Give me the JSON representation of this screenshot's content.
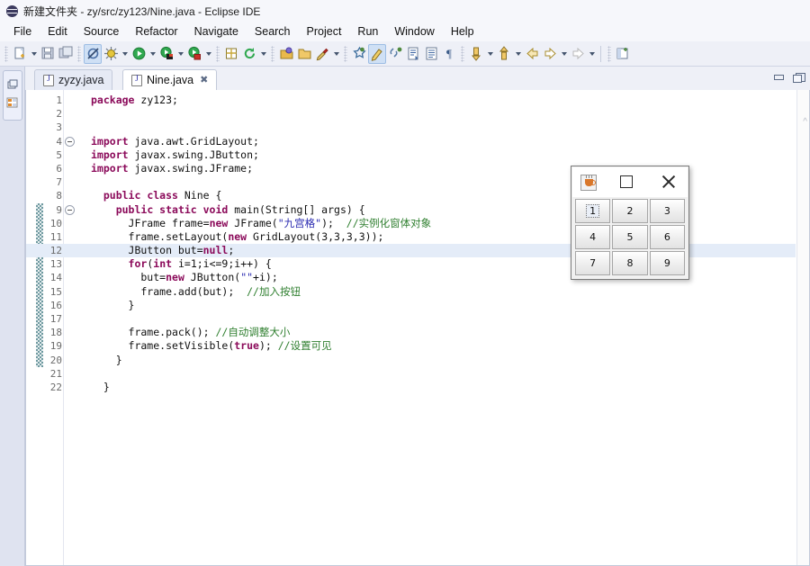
{
  "window": {
    "title": "新建文件夹 - zy/src/zy123/Nine.java - Eclipse IDE",
    "app_icon": "eclipse-icon"
  },
  "menubar": {
    "items": [
      {
        "label": "File",
        "name": "menu-file"
      },
      {
        "label": "Edit",
        "name": "menu-edit"
      },
      {
        "label": "Source",
        "name": "menu-source"
      },
      {
        "label": "Refactor",
        "name": "menu-refactor"
      },
      {
        "label": "Navigate",
        "name": "menu-navigate"
      },
      {
        "label": "Search",
        "name": "menu-search"
      },
      {
        "label": "Project",
        "name": "menu-project"
      },
      {
        "label": "Run",
        "name": "menu-run"
      },
      {
        "label": "Window",
        "name": "menu-window"
      },
      {
        "label": "Help",
        "name": "menu-help"
      }
    ]
  },
  "toolbar": {
    "groups": [
      {
        "items": [
          {
            "icon": "new-file-icon",
            "arrow": true,
            "selected": false
          },
          {
            "icon": "save-icon",
            "arrow": false,
            "selected": false
          },
          {
            "icon": "save-all-icon",
            "arrow": false,
            "selected": false
          }
        ]
      },
      {
        "items": [
          {
            "icon": "skip-all-breakpoints-icon",
            "arrow": false,
            "selected": true
          },
          {
            "icon": "debug-icon",
            "arrow": true,
            "selected": false
          },
          {
            "icon": "run-icon",
            "arrow": true,
            "selected": false
          },
          {
            "icon": "run-coverage-icon",
            "arrow": true,
            "selected": false
          },
          {
            "icon": "profile-icon",
            "arrow": true,
            "selected": false
          }
        ]
      },
      {
        "items": [
          {
            "icon": "new-java-package-icon",
            "arrow": false,
            "selected": false
          },
          {
            "icon": "refresh-icon",
            "arrow": true,
            "selected": false
          }
        ]
      },
      {
        "items": [
          {
            "icon": "open-type-icon",
            "arrow": false,
            "selected": false
          },
          {
            "icon": "open-resource-icon",
            "arrow": false,
            "selected": false
          },
          {
            "icon": "search-icon",
            "arrow": true,
            "selected": false
          }
        ]
      },
      {
        "items": [
          {
            "icon": "new-annotation-icon",
            "arrow": false,
            "selected": false
          },
          {
            "icon": "toggle-mark-occurrences-icon",
            "arrow": false,
            "selected": true
          },
          {
            "icon": "link-editor-icon",
            "arrow": false,
            "selected": false
          },
          {
            "icon": "show-source-icon",
            "arrow": false,
            "selected": false
          },
          {
            "icon": "show-whitespace-icon",
            "arrow": false,
            "selected": false
          },
          {
            "icon": "pilcrow-icon",
            "arrow": false,
            "selected": false
          }
        ]
      },
      {
        "items": [
          {
            "icon": "next-annotation-icon",
            "arrow": true,
            "selected": false
          },
          {
            "icon": "previous-annotation-icon",
            "arrow": true,
            "selected": false
          },
          {
            "icon": "back-icon",
            "arrow": false,
            "selected": false
          },
          {
            "icon": "forward-icon",
            "arrow": true,
            "selected": false
          },
          {
            "icon": "last-edit-location-icon",
            "arrow": true,
            "selected": false
          }
        ]
      },
      {
        "items": [
          {
            "icon": "open-perspective-icon",
            "arrow": false,
            "selected": false
          }
        ]
      }
    ]
  },
  "leftbar": {
    "icons": [
      {
        "name": "restore-view-icon"
      },
      {
        "name": "package-explorer-icon"
      }
    ]
  },
  "tabs": [
    {
      "label": "zyzy.java",
      "active": false,
      "closable": false,
      "name": "tab-zyzy-java"
    },
    {
      "label": "Nine.java",
      "active": true,
      "closable": true,
      "name": "tab-nine-java"
    }
  ],
  "editor_window_buttons": [
    {
      "name": "minimize-editor-button",
      "icon": "minimize-icon"
    },
    {
      "name": "maximize-editor-button",
      "icon": "maximize-icon"
    }
  ],
  "overview_ruler": {
    "caret": "^"
  },
  "code": {
    "current_line": 12,
    "fold_lines": [
      4,
      9
    ],
    "change_bar_from": 9,
    "change_bar_to": 20,
    "lines": [
      {
        "n": 1,
        "tokens": [
          {
            "t": "kw",
            "v": "package"
          },
          {
            "t": "pln",
            "v": " zy123;"
          }
        ]
      },
      {
        "n": 2,
        "tokens": []
      },
      {
        "n": 3,
        "tokens": []
      },
      {
        "n": 4,
        "tokens": [
          {
            "t": "kw",
            "v": "import"
          },
          {
            "t": "pln",
            "v": " java.awt.GridLayout;"
          }
        ]
      },
      {
        "n": 5,
        "tokens": [
          {
            "t": "kw",
            "v": "import"
          },
          {
            "t": "pln",
            "v": " javax.swing.JButton;"
          }
        ]
      },
      {
        "n": 6,
        "tokens": [
          {
            "t": "kw",
            "v": "import"
          },
          {
            "t": "pln",
            "v": " javax.swing.JFrame;"
          }
        ]
      },
      {
        "n": 7,
        "tokens": []
      },
      {
        "n": 8,
        "tokens": [
          {
            "t": "pln",
            "v": "  "
          },
          {
            "t": "kw",
            "v": "public class"
          },
          {
            "t": "pln",
            "v": " Nine {"
          }
        ]
      },
      {
        "n": 9,
        "tokens": [
          {
            "t": "pln",
            "v": "    "
          },
          {
            "t": "kw",
            "v": "public static void"
          },
          {
            "t": "pln",
            "v": " main(String[] args) {"
          }
        ]
      },
      {
        "n": 10,
        "tokens": [
          {
            "t": "pln",
            "v": "      JFrame frame="
          },
          {
            "t": "kw",
            "v": "new"
          },
          {
            "t": "pln",
            "v": " JFrame("
          },
          {
            "t": "str",
            "v": "\"九宫格\""
          },
          {
            "t": "pln",
            "v": ");  "
          },
          {
            "t": "cmt",
            "v": "//实例化窗体对象"
          }
        ]
      },
      {
        "n": 11,
        "tokens": [
          {
            "t": "pln",
            "v": "      frame.setLayout("
          },
          {
            "t": "kw",
            "v": "new"
          },
          {
            "t": "pln",
            "v": " GridLayout(3,3,3,3));"
          }
        ]
      },
      {
        "n": 12,
        "tokens": [
          {
            "t": "pln",
            "v": "      JButton but="
          },
          {
            "t": "kw",
            "v": "null"
          },
          {
            "t": "pln",
            "v": ";"
          }
        ]
      },
      {
        "n": 13,
        "tokens": [
          {
            "t": "pln",
            "v": "      "
          },
          {
            "t": "kw",
            "v": "for"
          },
          {
            "t": "pln",
            "v": "("
          },
          {
            "t": "kw",
            "v": "int"
          },
          {
            "t": "pln",
            "v": " i=1;i<=9;i++) {"
          }
        ]
      },
      {
        "n": 14,
        "tokens": [
          {
            "t": "pln",
            "v": "        but="
          },
          {
            "t": "kw",
            "v": "new"
          },
          {
            "t": "pln",
            "v": " JButton("
          },
          {
            "t": "str",
            "v": "\"\""
          },
          {
            "t": "pln",
            "v": "+i);"
          }
        ]
      },
      {
        "n": 15,
        "tokens": [
          {
            "t": "pln",
            "v": "        frame.add(but);  "
          },
          {
            "t": "cmt",
            "v": "//加入按钮"
          }
        ]
      },
      {
        "n": 16,
        "tokens": [
          {
            "t": "pln",
            "v": "      }"
          }
        ]
      },
      {
        "n": 17,
        "tokens": []
      },
      {
        "n": 18,
        "tokens": [
          {
            "t": "pln",
            "v": "      frame.pack(); "
          },
          {
            "t": "cmt",
            "v": "//自动调整大小"
          }
        ]
      },
      {
        "n": 19,
        "tokens": [
          {
            "t": "pln",
            "v": "      frame.setVisible("
          },
          {
            "t": "kw",
            "v": "true"
          },
          {
            "t": "pln",
            "v": "); "
          },
          {
            "t": "cmt",
            "v": "//设置可见"
          }
        ]
      },
      {
        "n": 20,
        "tokens": [
          {
            "t": "pln",
            "v": "    }"
          }
        ]
      },
      {
        "n": 21,
        "tokens": []
      },
      {
        "n": 22,
        "tokens": [
          {
            "t": "pln",
            "v": "  }"
          }
        ]
      }
    ]
  },
  "swing_window": {
    "system_icon": "java-cup-icon",
    "maximize_label": "□",
    "close_label": "✕",
    "buttons": [
      "1",
      "2",
      "3",
      "4",
      "5",
      "6",
      "7",
      "8",
      "9"
    ],
    "focused_button": "1"
  },
  "colors": {
    "accent": "#cfe0f5",
    "current_line": "#e4ecf8",
    "keyword": "#8b0a5a",
    "string": "#2a2ab0",
    "comment": "#2f7f2f",
    "chrome": "#eef0f7"
  }
}
